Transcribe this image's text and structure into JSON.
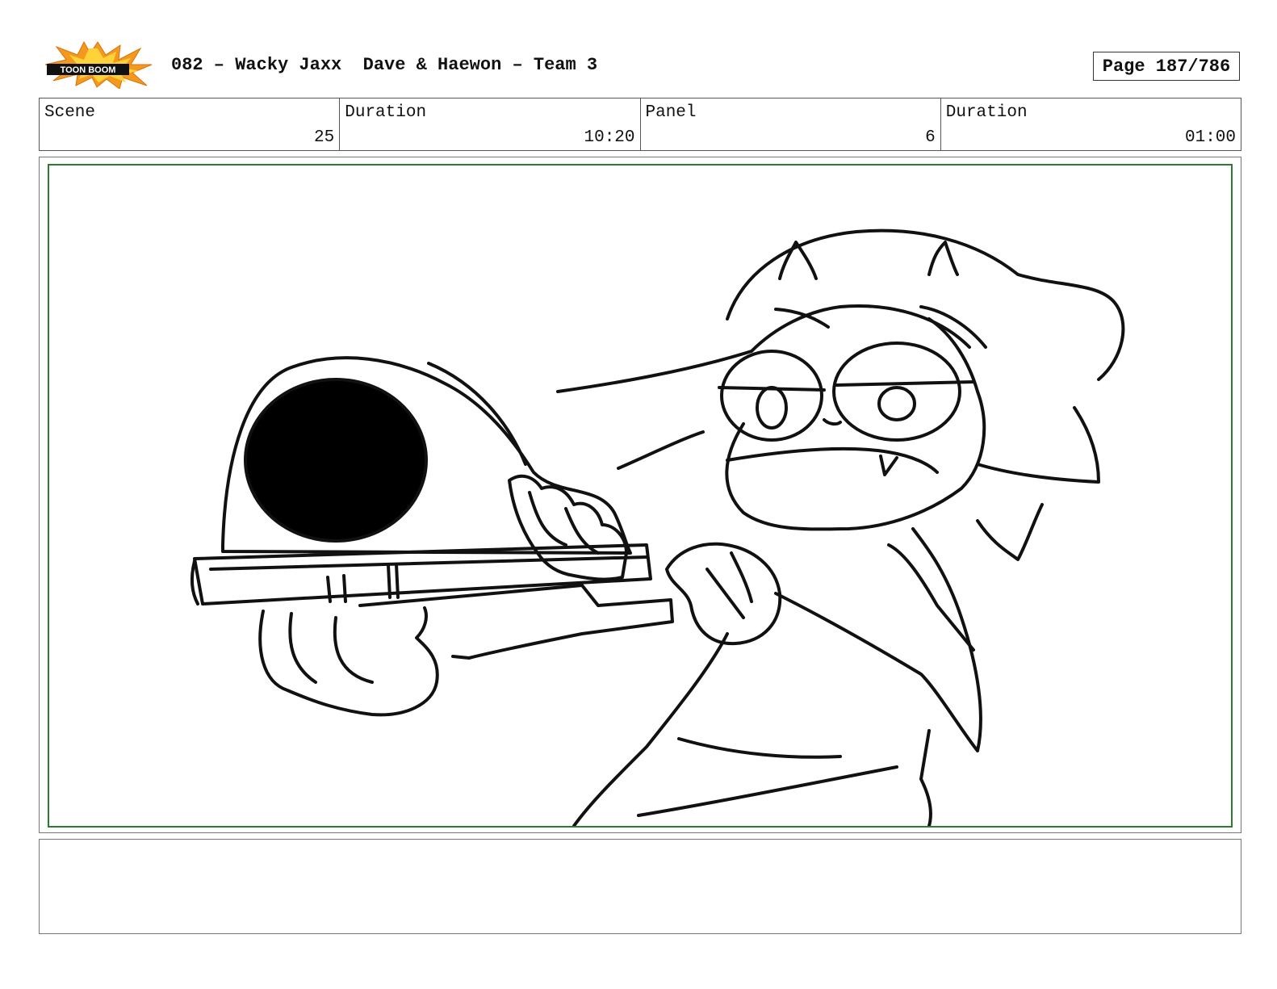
{
  "header": {
    "logo_text": "TOON BOOM",
    "title": "082 – Wacky Jaxx  Dave & Haewon – Team 3",
    "page": "Page 187/786"
  },
  "info": {
    "scene_label": "Scene",
    "scene_value": "25",
    "scene_duration_label": "Duration",
    "scene_duration_value": "10:20",
    "panel_label": "Panel",
    "panel_value": "6",
    "panel_duration_label": "Duration",
    "panel_duration_value": "01:00"
  },
  "colors": {
    "panel_border": "#2d7a33",
    "logo_orange": "#f39a1e",
    "logo_yellow": "#ffd23a"
  },
  "notes": {
    "text": ""
  }
}
